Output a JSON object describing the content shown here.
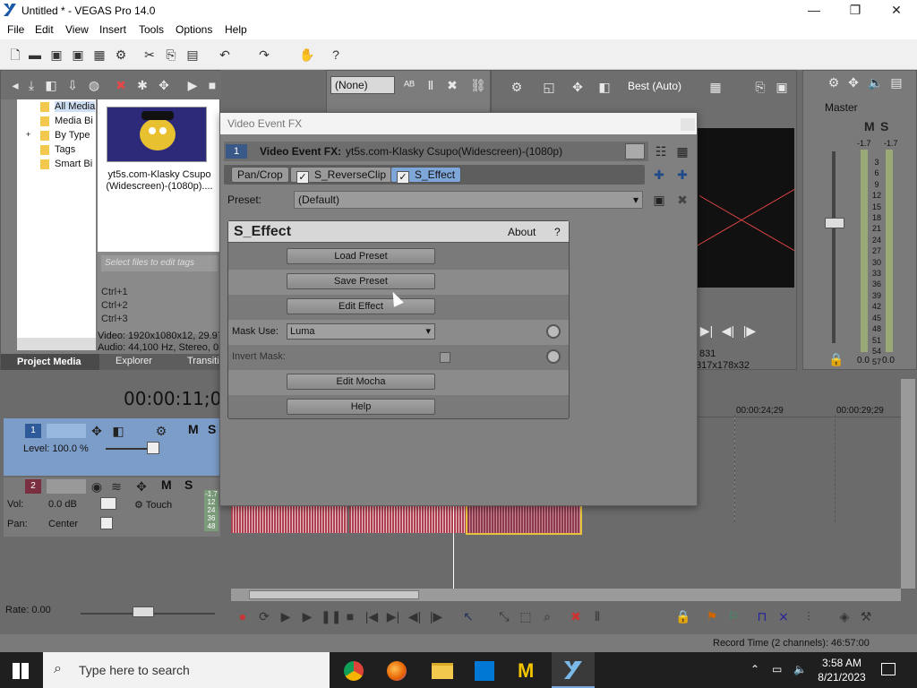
{
  "window": {
    "title": "Untitled * - VEGAS Pro 14.0",
    "min": "—",
    "max": "❐",
    "close": "✕"
  },
  "menu": [
    "File",
    "Edit",
    "View",
    "Insert",
    "Tools",
    "Options",
    "Help"
  ],
  "explorer": {
    "tree": [
      "All Media",
      "Media Bi",
      "By Type",
      "Tags",
      "Smart Bi"
    ],
    "media_name": "yt5s.com-Klasky Csupo (Widescreen)-(1080p)....",
    "tags_placeholder": "Select files to edit tags",
    "shortcuts": [
      "Ctrl+1",
      "Ctrl+2",
      "Ctrl+3"
    ],
    "video_info": "Video: 1920x1080x12, 29.97",
    "audio_info": "Audio: 44,100 Hz, Stereo, 0(",
    "tabs": [
      "Project Media",
      "Explorer",
      "Transiti"
    ]
  },
  "trimmer": {
    "none_label": "(None)"
  },
  "preview": {
    "quality": "Best (Auto)",
    "frame": "831",
    "size": "317x178x32"
  },
  "master": {
    "label": "Master",
    "levels": [
      "-1.7",
      "-1.7"
    ],
    "scale": [
      "3",
      "6",
      "9",
      "12",
      "15",
      "18",
      "21",
      "24",
      "27",
      "30",
      "33",
      "36",
      "39",
      "42",
      "45",
      "48",
      "51",
      "54",
      "57"
    ],
    "bottom": [
      "0.0",
      "0.0"
    ]
  },
  "timeline": {
    "time": "00:00:11;01",
    "ruler": [
      "00:00:24;29",
      "00:00:29;29"
    ],
    "video_track": {
      "num": "1",
      "level": "Level: 100.0 %",
      "m": "M",
      "s": "S"
    },
    "audio_track": {
      "num": "2",
      "vol": "Vol:",
      "vol_value": "0.0 dB",
      "pan": "Pan:",
      "pan_value": "Center",
      "touch": "Touch",
      "m": "M",
      "s": "S",
      "meter": [
        "-1.7",
        "12",
        "24",
        "36",
        "48"
      ]
    },
    "rate": "Rate: 0.00",
    "record_time": "Record Time (2 channels): 46:57:00"
  },
  "dialog": {
    "title": "Video Event FX",
    "index": "1",
    "header_label": "Video Event FX:",
    "header_value": "yt5s.com-Klasky Csupo(Widescreen)-(1080p)",
    "chain": [
      "Pan/Crop",
      "S_ReverseClip",
      "S_Effect"
    ],
    "preset_label": "Preset:",
    "preset_value": "(Default)",
    "plugin": {
      "name": "S_Effect",
      "about": "About",
      "help_q": "?",
      "load_preset": "Load Preset",
      "save_preset": "Save Preset",
      "edit_effect": "Edit Effect",
      "mask_use_label": "Mask Use:",
      "mask_use_value": "Luma",
      "invert_mask_label": "Invert Mask:",
      "edit_mocha": "Edit Mocha",
      "help": "Help"
    }
  },
  "taskbar": {
    "search_placeholder": "Type here to search",
    "time": "3:58 AM",
    "date": "8/21/2023"
  }
}
